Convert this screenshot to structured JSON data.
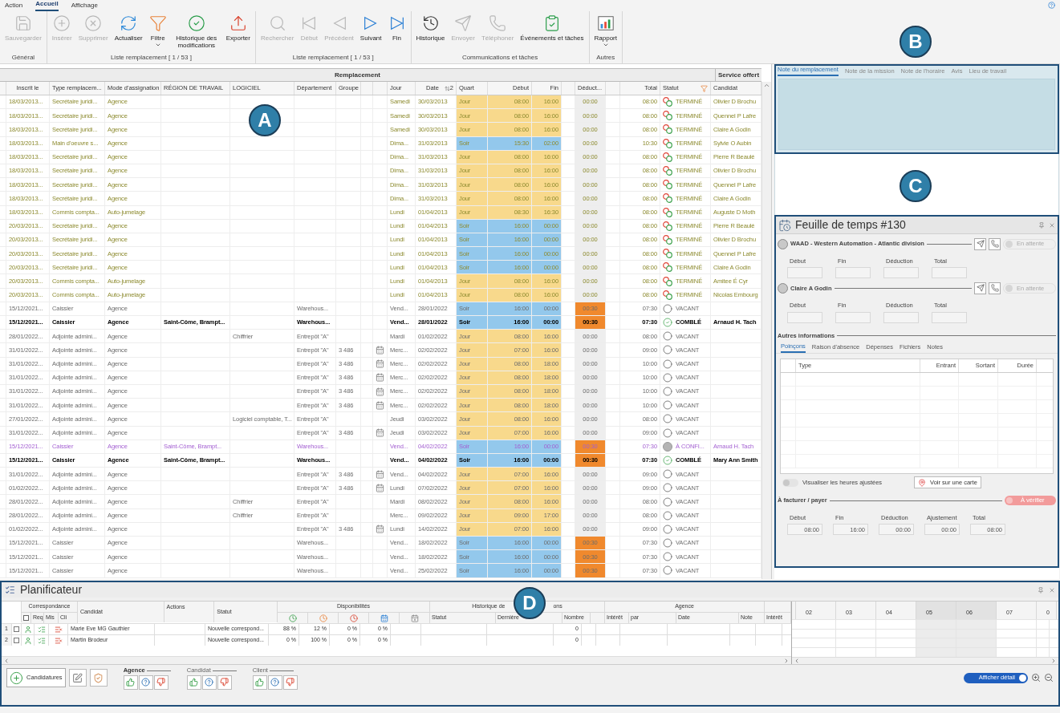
{
  "menu": {
    "tabs": [
      {
        "label": "Action",
        "selected": false
      },
      {
        "label": "Accueil",
        "selected": true
      },
      {
        "label": "Affichage",
        "selected": false
      }
    ]
  },
  "ribbon": {
    "groups": [
      {
        "label": "Général",
        "buttons": [
          {
            "label": "Sauvegarder",
            "disabled": true,
            "dropdown": false
          }
        ]
      },
      {
        "label": "Liste remplacement [ 1 / 53 ]",
        "buttons": [
          {
            "label": "Insérer",
            "disabled": true,
            "dropdown": false
          },
          {
            "label": "Supprimer",
            "disabled": true,
            "dropdown": false
          },
          {
            "label": "Actualiser",
            "disabled": false,
            "dropdown": false
          },
          {
            "label": "Filtre",
            "disabled": false,
            "dropdown": true
          },
          {
            "label": "Historique des modifications",
            "disabled": false,
            "dropdown": false
          },
          {
            "label": "Exporter",
            "disabled": false,
            "dropdown": false
          }
        ]
      },
      {
        "label": "Liste remplacement [ 1 / 53 ]",
        "buttons": [
          {
            "label": "Rechercher",
            "disabled": true,
            "dropdown": false
          },
          {
            "label": "Début",
            "disabled": true,
            "dropdown": false
          },
          {
            "label": "Précédent",
            "disabled": true,
            "dropdown": false
          },
          {
            "label": "Suivant",
            "disabled": false,
            "dropdown": false
          },
          {
            "label": "Fin",
            "disabled": false,
            "dropdown": false
          }
        ]
      },
      {
        "label": "Communications et tâches",
        "buttons": [
          {
            "label": "Historique",
            "disabled": false,
            "dropdown": false
          },
          {
            "label": "Envoyer",
            "disabled": true,
            "dropdown": false
          },
          {
            "label": "Téléphoner",
            "disabled": true,
            "dropdown": false
          },
          {
            "label": "Événements et tâches",
            "disabled": false,
            "dropdown": false
          }
        ]
      },
      {
        "label": "Autres",
        "buttons": [
          {
            "label": "Rapport",
            "disabled": false,
            "dropdown": true
          }
        ]
      }
    ]
  },
  "annotations": [
    {
      "label": "A"
    },
    {
      "label": "B"
    },
    {
      "label": "C"
    },
    {
      "label": "D"
    }
  ],
  "table": {
    "group_headers": [
      "Remplacement",
      "Service offert"
    ],
    "columns": [
      "Inscrit le",
      "Type remplacem...",
      "Mode d'assignation",
      "RÉGION DE TRAVAIL",
      "LOGICIEL",
      "Département",
      "Groupe",
      "Jour",
      "Date",
      "Quart",
      "Début",
      "Fin",
      "Déduct...",
      "Total",
      "Statut",
      "Candidat"
    ],
    "sort_order": "2",
    "rows": [
      {
        "kind": "past",
        "inscrit": "18/03/2013...",
        "type": "Secrétaire juridi...",
        "mode": "Agence",
        "jour": "Samedi",
        "date": "30/03/2013",
        "quart": {
          "label": "Jour",
          "kind": "day"
        },
        "debut": "08:00",
        "fin": "16:00",
        "deduction": "00:00",
        "deduction_alert": false,
        "total": "08:00",
        "statut": {
          "label": "TERMINÉ",
          "kind": "done"
        },
        "candidat": "Olivier D Brochu",
        "calendar": false
      },
      {
        "kind": "past",
        "inscrit": "18/03/2013...",
        "type": "Secrétaire juridi...",
        "mode": "Agence",
        "jour": "Samedi",
        "date": "30/03/2013",
        "quart": {
          "label": "Jour",
          "kind": "day"
        },
        "debut": "08:00",
        "fin": "16:00",
        "deduction": "00:00",
        "deduction_alert": false,
        "total": "08:00",
        "statut": {
          "label": "TERMINÉ",
          "kind": "done"
        },
        "candidat": "Quennel P Lafre",
        "calendar": false
      },
      {
        "kind": "past",
        "inscrit": "18/03/2013...",
        "type": "Secrétaire juridi...",
        "mode": "Agence",
        "jour": "Samedi",
        "date": "30/03/2013",
        "quart": {
          "label": "Jour",
          "kind": "day"
        },
        "debut": "08:00",
        "fin": "16:00",
        "deduction": "00:00",
        "deduction_alert": false,
        "total": "08:00",
        "statut": {
          "label": "TERMINÉ",
          "kind": "done"
        },
        "candidat": "Claire A Godin",
        "calendar": false
      },
      {
        "kind": "past",
        "inscrit": "18/03/2013...",
        "type": "Main d'oeuvre s...",
        "mode": "Agence",
        "jour": "Dima...",
        "date": "31/03/2013",
        "quart": {
          "label": "Soir",
          "kind": "evening"
        },
        "debut": "15:30",
        "fin": "02:00",
        "deduction": "00:00",
        "deduction_alert": false,
        "total": "10:30",
        "statut": {
          "label": "TERMINÉ",
          "kind": "done"
        },
        "candidat": "Sylvie O Aubin",
        "calendar": false
      },
      {
        "kind": "past",
        "inscrit": "18/03/2013...",
        "type": "Secrétaire juridi...",
        "mode": "Agence",
        "jour": "Dima...",
        "date": "31/03/2013",
        "quart": {
          "label": "Jour",
          "kind": "day"
        },
        "debut": "08:00",
        "fin": "16:00",
        "deduction": "00:00",
        "deduction_alert": false,
        "total": "08:00",
        "statut": {
          "label": "TERMINÉ",
          "kind": "done"
        },
        "candidat": "Pierre R Beaulé",
        "calendar": false
      },
      {
        "kind": "past",
        "inscrit": "18/03/2013...",
        "type": "Secrétaire juridi...",
        "mode": "Agence",
        "jour": "Dima...",
        "date": "31/03/2013",
        "quart": {
          "label": "Jour",
          "kind": "day"
        },
        "debut": "08:00",
        "fin": "16:00",
        "deduction": "00:00",
        "deduction_alert": false,
        "total": "08:00",
        "statut": {
          "label": "TERMINÉ",
          "kind": "done"
        },
        "candidat": "Olivier D Brochu",
        "calendar": false
      },
      {
        "kind": "past",
        "inscrit": "18/03/2013...",
        "type": "Secrétaire juridi...",
        "mode": "Agence",
        "jour": "Dima...",
        "date": "31/03/2013",
        "quart": {
          "label": "Jour",
          "kind": "day"
        },
        "debut": "08:00",
        "fin": "16:00",
        "deduction": "00:00",
        "deduction_alert": false,
        "total": "08:00",
        "statut": {
          "label": "TERMINÉ",
          "kind": "done"
        },
        "candidat": "Quennel P Lafre",
        "calendar": false
      },
      {
        "kind": "past",
        "inscrit": "18/03/2013...",
        "type": "Secrétaire juridi...",
        "mode": "Agence",
        "jour": "Dima...",
        "date": "31/03/2013",
        "quart": {
          "label": "Jour",
          "kind": "day"
        },
        "debut": "08:00",
        "fin": "16:00",
        "deduction": "00:00",
        "deduction_alert": false,
        "total": "08:00",
        "statut": {
          "label": "TERMINÉ",
          "kind": "done"
        },
        "candidat": "Claire A Godin",
        "calendar": false
      },
      {
        "kind": "past",
        "inscrit": "18/03/2013...",
        "type": "Commis compta...",
        "mode": "Auto-jumelage",
        "jour": "Lundi",
        "date": "01/04/2013",
        "quart": {
          "label": "Jour",
          "kind": "day"
        },
        "debut": "08:30",
        "fin": "16:30",
        "deduction": "00:00",
        "deduction_alert": false,
        "total": "08:00",
        "statut": {
          "label": "TERMINÉ",
          "kind": "done"
        },
        "candidat": "Auguste D Moth",
        "calendar": false
      },
      {
        "kind": "past",
        "inscrit": "20/03/2013...",
        "type": "Secrétaire juridi...",
        "mode": "Agence",
        "jour": "Lundi",
        "date": "01/04/2013",
        "quart": {
          "label": "Soir",
          "kind": "evening"
        },
        "debut": "16:00",
        "fin": "00:00",
        "deduction": "00:00",
        "deduction_alert": false,
        "total": "08:00",
        "statut": {
          "label": "TERMINÉ",
          "kind": "done"
        },
        "candidat": "Pierre R Beaulé",
        "calendar": false
      },
      {
        "kind": "past",
        "inscrit": "20/03/2013...",
        "type": "Secrétaire juridi...",
        "mode": "Agence",
        "jour": "Lundi",
        "date": "01/04/2013",
        "quart": {
          "label": "Soir",
          "kind": "evening"
        },
        "debut": "16:00",
        "fin": "00:00",
        "deduction": "00:00",
        "deduction_alert": false,
        "total": "08:00",
        "statut": {
          "label": "TERMINÉ",
          "kind": "done"
        },
        "candidat": "Olivier D Brochu",
        "calendar": false
      },
      {
        "kind": "past",
        "inscrit": "20/03/2013...",
        "type": "Secrétaire juridi...",
        "mode": "Agence",
        "jour": "Lundi",
        "date": "01/04/2013",
        "quart": {
          "label": "Soir",
          "kind": "evening"
        },
        "debut": "16:00",
        "fin": "00:00",
        "deduction": "00:00",
        "deduction_alert": false,
        "total": "08:00",
        "statut": {
          "label": "TERMINÉ",
          "kind": "done"
        },
        "candidat": "Quennel P Lafre",
        "calendar": false
      },
      {
        "kind": "past",
        "inscrit": "20/03/2013...",
        "type": "Secrétaire juridi...",
        "mode": "Agence",
        "jour": "Lundi",
        "date": "01/04/2013",
        "quart": {
          "label": "Soir",
          "kind": "evening"
        },
        "debut": "16:00",
        "fin": "00:00",
        "deduction": "00:00",
        "deduction_alert": false,
        "total": "08:00",
        "statut": {
          "label": "TERMINÉ",
          "kind": "done"
        },
        "candidat": "Claire A Godin",
        "calendar": false
      },
      {
        "kind": "past",
        "inscrit": "20/03/2013...",
        "type": "Commis compta...",
        "mode": "Auto-jumelage",
        "jour": "Lundi",
        "date": "01/04/2013",
        "quart": {
          "label": "Jour",
          "kind": "day"
        },
        "debut": "08:00",
        "fin": "16:00",
        "deduction": "00:00",
        "deduction_alert": false,
        "total": "08:00",
        "statut": {
          "label": "TERMINÉ",
          "kind": "done"
        },
        "candidat": "Amitee É Cyr",
        "calendar": false
      },
      {
        "kind": "past",
        "inscrit": "20/03/2013...",
        "type": "Commis compta...",
        "mode": "Auto-jumelage",
        "jour": "Lundi",
        "date": "01/04/2013",
        "quart": {
          "label": "Jour",
          "kind": "day"
        },
        "debut": "08:00",
        "fin": "16:00",
        "deduction": "00:00",
        "deduction_alert": false,
        "total": "08:00",
        "statut": {
          "label": "TERMINÉ",
          "kind": "done"
        },
        "candidat": "Nicolas Embourg",
        "calendar": false
      },
      {
        "kind": "normal",
        "inscrit": "15/12/2021...",
        "type": "Caissier",
        "mode": "Agence",
        "departement": "Warehous...",
        "jour": "Vend...",
        "date": "28/01/2022",
        "quart": {
          "label": "Soir",
          "kind": "evening"
        },
        "debut": "16:00",
        "fin": "00:00",
        "deduction": "00:30",
        "deduction_alert": true,
        "total": "07:30",
        "statut": {
          "label": "VACANT",
          "kind": "vacant"
        },
        "calendar": false
      },
      {
        "kind": "bold",
        "inscrit": "15/12/2021...",
        "type": "Caissier",
        "mode": "Agence",
        "region": "Saint-Côme, Brampt...",
        "departement": "Warehous...",
        "jour": "Vend...",
        "date": "28/01/2022",
        "quart": {
          "label": "Soir",
          "kind": "evening"
        },
        "debut": "16:00",
        "fin": "00:00",
        "deduction": "00:30",
        "deduction_alert": true,
        "total": "07:30",
        "statut": {
          "label": "COMBLÉ",
          "kind": "filled"
        },
        "candidat": "Arnaud H. Tach",
        "calendar": false
      },
      {
        "kind": "normal",
        "inscrit": "28/01/2022...",
        "type": "Adjointe admini...",
        "mode": "Agence",
        "logiciel": "Chiffrier",
        "departement": "Entrepôt \"A\"",
        "jour": "Mardi",
        "date": "01/02/2022",
        "quart": {
          "label": "Jour",
          "kind": "day"
        },
        "debut": "08:00",
        "fin": "16:00",
        "deduction": "00:00",
        "deduction_alert": false,
        "total": "08:00",
        "statut": {
          "label": "VACANT",
          "kind": "vacant"
        },
        "calendar": false
      },
      {
        "kind": "normal",
        "inscrit": "31/01/2022...",
        "type": "Adjointe admini...",
        "mode": "Agence",
        "departement": "Entrepôt \"A\"",
        "groupe": "3 486",
        "jour": "Merc...",
        "date": "02/02/2022",
        "quart": {
          "label": "Jour",
          "kind": "day"
        },
        "debut": "07:00",
        "fin": "16:00",
        "deduction": "00:00",
        "deduction_alert": false,
        "total": "09:00",
        "statut": {
          "label": "VACANT",
          "kind": "vacant"
        },
        "calendar": true
      },
      {
        "kind": "normal",
        "inscrit": "31/01/2022...",
        "type": "Adjointe admini...",
        "mode": "Agence",
        "departement": "Entrepôt \"A\"",
        "groupe": "3 486",
        "jour": "Merc...",
        "date": "02/02/2022",
        "quart": {
          "label": "Jour",
          "kind": "day"
        },
        "debut": "08:00",
        "fin": "18:00",
        "deduction": "00:00",
        "deduction_alert": false,
        "total": "10:00",
        "statut": {
          "label": "VACANT",
          "kind": "vacant"
        },
        "calendar": true
      },
      {
        "kind": "normal",
        "inscrit": "31/01/2022...",
        "type": "Adjointe admini...",
        "mode": "Agence",
        "departement": "Entrepôt \"A\"",
        "groupe": "3 486",
        "jour": "Merc...",
        "date": "02/02/2022",
        "quart": {
          "label": "Jour",
          "kind": "day"
        },
        "debut": "08:00",
        "fin": "18:00",
        "deduction": "00:00",
        "deduction_alert": false,
        "total": "10:00",
        "statut": {
          "label": "VACANT",
          "kind": "vacant"
        },
        "calendar": true
      },
      {
        "kind": "normal",
        "inscrit": "31/01/2022...",
        "type": "Adjointe admini...",
        "mode": "Agence",
        "departement": "Entrepôt \"A\"",
        "groupe": "3 486",
        "jour": "Merc...",
        "date": "02/02/2022",
        "quart": {
          "label": "Jour",
          "kind": "day"
        },
        "debut": "08:00",
        "fin": "18:00",
        "deduction": "00:00",
        "deduction_alert": false,
        "total": "10:00",
        "statut": {
          "label": "VACANT",
          "kind": "vacant"
        },
        "calendar": true
      },
      {
        "kind": "normal",
        "inscrit": "31/01/2022...",
        "type": "Adjointe admini...",
        "mode": "Agence",
        "departement": "Entrepôt \"A\"",
        "groupe": "3 486",
        "jour": "Merc...",
        "date": "02/02/2022",
        "quart": {
          "label": "Jour",
          "kind": "day"
        },
        "debut": "08:00",
        "fin": "18:00",
        "deduction": "00:00",
        "deduction_alert": false,
        "total": "10:00",
        "statut": {
          "label": "VACANT",
          "kind": "vacant"
        },
        "calendar": true
      },
      {
        "kind": "normal",
        "inscrit": "27/01/2022...",
        "type": "Adjointe admini...",
        "mode": "Agence",
        "logiciel": "Logiciel comptable, T...",
        "departement": "Entrepôt \"A\"",
        "jour": "Jeudi",
        "date": "03/02/2022",
        "quart": {
          "label": "Jour",
          "kind": "day"
        },
        "debut": "08:00",
        "fin": "16:00",
        "deduction": "00:00",
        "deduction_alert": false,
        "total": "08:00",
        "statut": {
          "label": "VACANT",
          "kind": "vacant"
        },
        "calendar": false
      },
      {
        "kind": "normal",
        "inscrit": "31/01/2022...",
        "type": "Adjointe admini...",
        "mode": "Agence",
        "departement": "Entrepôt \"A\"",
        "groupe": "3 486",
        "jour": "Jeudi",
        "date": "03/02/2022",
        "quart": {
          "label": "Jour",
          "kind": "day"
        },
        "debut": "07:00",
        "fin": "16:00",
        "deduction": "00:00",
        "deduction_alert": false,
        "total": "09:00",
        "statut": {
          "label": "VACANT",
          "kind": "vacant"
        },
        "calendar": true
      },
      {
        "kind": "pending",
        "inscrit": "15/12/2021...",
        "type": "Caissier",
        "mode": "Agence",
        "region": "Saint-Côme, Brampt...",
        "departement": "Warehous...",
        "jour": "Vend...",
        "date": "04/02/2022",
        "quart": {
          "label": "Soir",
          "kind": "evening"
        },
        "debut": "16:00",
        "fin": "00:00",
        "deduction": "00:30",
        "deduction_alert": true,
        "total": "07:30",
        "statut": {
          "label": "À CONFI...",
          "kind": "pending"
        },
        "candidat": "Arnaud H. Tach",
        "calendar": false
      },
      {
        "kind": "bold",
        "inscrit": "15/12/2021...",
        "type": "Caissier",
        "mode": "Agence",
        "region": "Saint-Côme, Brampt...",
        "departement": "Warehous...",
        "jour": "Vend...",
        "date": "04/02/2022",
        "quart": {
          "label": "Soir",
          "kind": "evening"
        },
        "debut": "16:00",
        "fin": "00:00",
        "deduction": "00:30",
        "deduction_alert": true,
        "total": "07:30",
        "statut": {
          "label": "COMBLÉ",
          "kind": "filled"
        },
        "candidat": "Mary Ann Smith",
        "calendar": false
      },
      {
        "kind": "normal",
        "inscrit": "31/01/2022...",
        "type": "Adjointe admini...",
        "mode": "Agence",
        "departement": "Entrepôt \"A\"",
        "groupe": "3 486",
        "jour": "Vend...",
        "date": "04/02/2022",
        "quart": {
          "label": "Jour",
          "kind": "day"
        },
        "debut": "07:00",
        "fin": "16:00",
        "deduction": "00:00",
        "deduction_alert": false,
        "total": "09:00",
        "statut": {
          "label": "VACANT",
          "kind": "vacant"
        },
        "calendar": true
      },
      {
        "kind": "normal",
        "inscrit": "01/02/2022...",
        "type": "Adjointe admini...",
        "mode": "Agence",
        "departement": "Entrepôt \"A\"",
        "groupe": "3 486",
        "jour": "Lundi",
        "date": "07/02/2022",
        "quart": {
          "label": "Jour",
          "kind": "day"
        },
        "debut": "07:00",
        "fin": "16:00",
        "deduction": "00:00",
        "deduction_alert": false,
        "total": "09:00",
        "statut": {
          "label": "VACANT",
          "kind": "vacant"
        },
        "calendar": true
      },
      {
        "kind": "normal",
        "inscrit": "28/01/2022...",
        "type": "Adjointe admini...",
        "mode": "Agence",
        "logiciel": "Chiffrier",
        "departement": "Entrepôt \"A\"",
        "jour": "Mardi",
        "date": "08/02/2022",
        "quart": {
          "label": "Jour",
          "kind": "day"
        },
        "debut": "08:00",
        "fin": "16:00",
        "deduction": "00:00",
        "deduction_alert": false,
        "total": "08:00",
        "statut": {
          "label": "VACANT",
          "kind": "vacant"
        },
        "calendar": false
      },
      {
        "kind": "normal",
        "inscrit": "28/01/2022...",
        "type": "Adjointe admini...",
        "mode": "Agence",
        "logiciel": "Chiffrier",
        "departement": "Entrepôt \"A\"",
        "jour": "Merc...",
        "date": "09/02/2022",
        "quart": {
          "label": "Jour",
          "kind": "day"
        },
        "debut": "09:00",
        "fin": "17:00",
        "deduction": "00:00",
        "deduction_alert": false,
        "total": "08:00",
        "statut": {
          "label": "VACANT",
          "kind": "vacant"
        },
        "calendar": false
      },
      {
        "kind": "normal",
        "inscrit": "01/02/2022...",
        "type": "Adjointe admini...",
        "mode": "Agence",
        "departement": "Entrepôt \"A\"",
        "groupe": "3 486",
        "jour": "Lundi",
        "date": "14/02/2022",
        "quart": {
          "label": "Jour",
          "kind": "day"
        },
        "debut": "07:00",
        "fin": "16:00",
        "deduction": "00:00",
        "deduction_alert": false,
        "total": "09:00",
        "statut": {
          "label": "VACANT",
          "kind": "vacant"
        },
        "calendar": true
      },
      {
        "kind": "normal",
        "inscrit": "15/12/2021...",
        "type": "Caissier",
        "mode": "Agence",
        "departement": "Warehous...",
        "jour": "Vend...",
        "date": "18/02/2022",
        "quart": {
          "label": "Soir",
          "kind": "evening"
        },
        "debut": "16:00",
        "fin": "00:00",
        "deduction": "00:30",
        "deduction_alert": true,
        "total": "07:30",
        "statut": {
          "label": "VACANT",
          "kind": "vacant"
        },
        "calendar": false
      },
      {
        "kind": "normal",
        "inscrit": "15/12/2021...",
        "type": "Caissier",
        "mode": "Agence",
        "departement": "Warehous...",
        "jour": "Vend...",
        "date": "18/02/2022",
        "quart": {
          "label": "Soir",
          "kind": "evening"
        },
        "debut": "16:00",
        "fin": "00:00",
        "deduction": "00:30",
        "deduction_alert": true,
        "total": "07:30",
        "statut": {
          "label": "VACANT",
          "kind": "vacant"
        },
        "calendar": false
      },
      {
        "kind": "normal",
        "inscrit": "15/12/2021...",
        "type": "Caissier",
        "mode": "Agence",
        "departement": "Warehous...",
        "jour": "Vend...",
        "date": "25/02/2022",
        "quart": {
          "label": "Soir",
          "kind": "evening"
        },
        "debut": "16:00",
        "fin": "00:00",
        "deduction": "00:30",
        "deduction_alert": true,
        "total": "07:30",
        "statut": {
          "label": "VACANT",
          "kind": "vacant"
        },
        "calendar": false
      }
    ]
  },
  "notes": {
    "tabs": [
      {
        "label": "Note du remplacement",
        "selected": true
      },
      {
        "label": "Note de la mission",
        "selected": false
      },
      {
        "label": "Note de l'horaire",
        "selected": false
      },
      {
        "label": "Avis",
        "selected": false
      },
      {
        "label": "Lieu de travail",
        "selected": false
      }
    ]
  },
  "timesheet": {
    "title": "Feuille de temps #130",
    "parties": [
      {
        "name": "WAAD - Western Automation - Atlantic division",
        "status": "En attente",
        "on": false,
        "fields": [
          "Début",
          "Fin",
          "Déduction",
          "Total"
        ]
      },
      {
        "name": "Claire A Godin",
        "status": "En attente",
        "on": false,
        "fields": [
          "Début",
          "Fin",
          "Déduction",
          "Total"
        ]
      }
    ],
    "other_title": "Autres informations",
    "tabs": [
      {
        "label": "Poinçons",
        "selected": true
      },
      {
        "label": "Raison d'absence",
        "selected": false
      },
      {
        "label": "Dépenses",
        "selected": false
      },
      {
        "label": "Fichiers",
        "selected": false
      },
      {
        "label": "Notes",
        "selected": false
      }
    ],
    "punch_columns": [
      "Type",
      "Entrant",
      "Sortant",
      "Durée"
    ],
    "adjusted_toggle": {
      "label": "Visualiser les heures ajustées",
      "on": false
    },
    "map_button": "Voir sur une carte",
    "billing": {
      "title": "À facturer / payer",
      "status": "À vérifier",
      "on": false,
      "fields": [
        {
          "label": "Début",
          "value": "08:00"
        },
        {
          "label": "Fin",
          "value": "16:00"
        },
        {
          "label": "Déduction",
          "value": "00:00"
        },
        {
          "label": "Ajustement",
          "value": "00:00"
        },
        {
          "label": "Total",
          "value": "08:00"
        }
      ]
    }
  },
  "planner": {
    "title": "Planificateur",
    "select_all_checked": false,
    "headers": {
      "correspondance": "Correspondance",
      "req": "Req",
      "mis": "Mis",
      "cli": "Cli",
      "candidat": "Candidat",
      "actions": "Actions",
      "statut": "Statut",
      "disponibilites": "Disponibilités",
      "historique_start": "Historique de",
      "historique_end": "ons",
      "hist_statut": "Statut",
      "derniere": "Dernière",
      "nombre": "Nombre",
      "agence": "Agence",
      "interet": "Intérêt",
      "par": "par",
      "date": "Date",
      "note": "Note",
      "interet_2": "Intérêt"
    },
    "days": [
      {
        "label": "02",
        "weekend": false
      },
      {
        "label": "03",
        "weekend": false
      },
      {
        "label": "04",
        "weekend": false
      },
      {
        "label": "05",
        "weekend": true
      },
      {
        "label": "06",
        "weekend": true
      },
      {
        "label": "07",
        "weekend": false
      },
      {
        "label": "0",
        "weekend": false
      }
    ],
    "rows": [
      {
        "number": "1",
        "checked": false,
        "candidat": "Marie Eve MG Gauthier",
        "statut": "Nouvelle correspond...",
        "availability": [
          "88 %",
          "12 %",
          "0 %",
          "0 %"
        ],
        "nombre": "0"
      },
      {
        "number": "2",
        "checked": false,
        "candidat": "Martin Brodeur",
        "statut": "Nouvelle correspond...",
        "availability": [
          "0 %",
          "100 %",
          "0 %",
          "0 %"
        ],
        "nombre": "0"
      }
    ],
    "add_button": "Candidatures",
    "vote_groups": [
      "Agence",
      "Candidat",
      "Client"
    ],
    "detail_toggle": {
      "label": "Afficher détail",
      "on": true
    }
  }
}
